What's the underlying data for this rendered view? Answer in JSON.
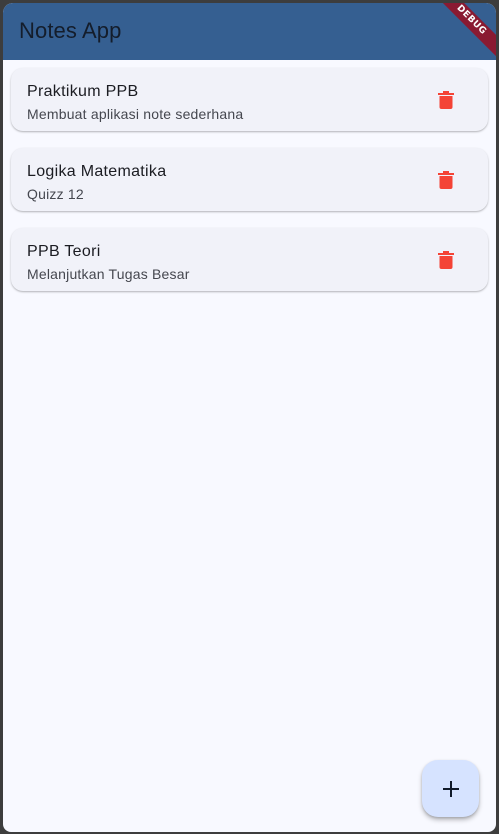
{
  "appbar": {
    "title": "Notes App",
    "debug_label": "DEBUG"
  },
  "notes": [
    {
      "title": "Praktikum PPB",
      "subtitle": "Membuat aplikasi note sederhana"
    },
    {
      "title": "Logika Matematika",
      "subtitle": "Quizz 12"
    },
    {
      "title": "PPB Teori",
      "subtitle": "Melanjutkan Tugas Besar"
    }
  ],
  "icons": {
    "delete": "trash-icon",
    "add": "plus-icon"
  },
  "colors": {
    "appbar": "#355f91",
    "background": "#f8f9ff",
    "card": "#f1f2f9",
    "delete_icon": "#f44336",
    "fab": "#d6e3ff",
    "debug_banner": "#8a1a32"
  }
}
